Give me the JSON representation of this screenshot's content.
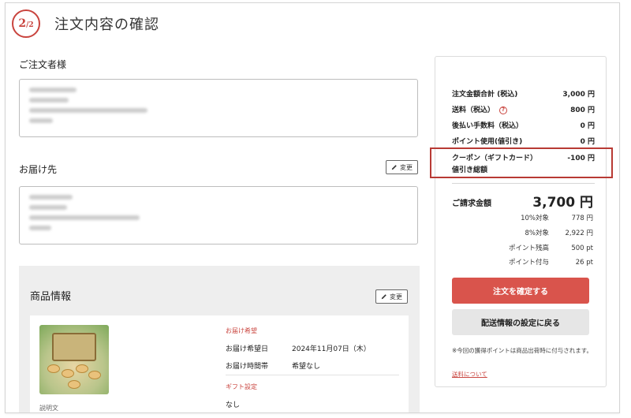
{
  "header": {
    "step_current": "2",
    "step_total": "2",
    "title": "注文内容の確認"
  },
  "orderer": {
    "heading": "ご注文者様"
  },
  "delivery": {
    "heading": "お届け先",
    "edit_label": "変更"
  },
  "product": {
    "heading": "商品情報",
    "edit_label": "変更",
    "caption": "説明文",
    "delivery_wish_label": "お届け希望",
    "date_label": "お届け希望日",
    "date_value": "2024年11月07日（木）",
    "time_label": "お届け時間帯",
    "time_value": "希望なし",
    "gift_label": "ギフト設定",
    "gift_value": "なし"
  },
  "summary": {
    "rows": [
      {
        "label": "注文金額合計 (税込)",
        "value": "3,000 円"
      },
      {
        "label": "送料（税込）",
        "value": "800 円",
        "icon": "question-icon"
      },
      {
        "label": "後払い手数料（税込）",
        "value": "0 円"
      },
      {
        "label": "ポイント使用(値引き)",
        "value": "0 円"
      }
    ],
    "coupon_label": "クーポン（ギフトカード）",
    "coupon_value": "-100 円",
    "discount_total_label": "値引き総額",
    "total_label": "ご請求金額",
    "total_value": "3,700 円",
    "breakdown": [
      {
        "label": "10%対象",
        "value": "778 円"
      },
      {
        "label": "8%対象",
        "value": "2,922 円"
      },
      {
        "label": "ポイント残高",
        "value": "500 pt"
      },
      {
        "label": "ポイント付与",
        "value": "26 pt"
      }
    ],
    "confirm_button": "注文を確定する",
    "back_button": "配送情報の設定に戻る",
    "note": "※今回の獲得ポイントは商品出荷時に付与されます。",
    "shipping_link": "送料について"
  },
  "colors": {
    "accent": "#c9443e",
    "confirm_bg": "#d9544c",
    "highlight_border": "#b83a34"
  }
}
